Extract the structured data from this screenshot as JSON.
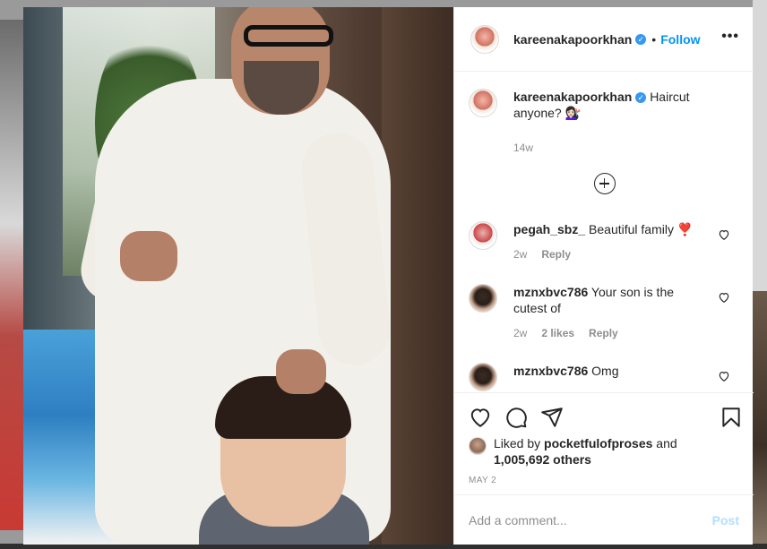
{
  "post": {
    "author": "kareenakapoorkhan",
    "verified_mark": "✓",
    "dot": "•",
    "follow_label": "Follow",
    "more_label": "•••",
    "caption": "Haircut anyone? 💇🏻‍♀️",
    "caption_time": "14w",
    "likes_prefix": "Liked by",
    "liked_by_user": "pocketfulofproses",
    "likes_and": "and",
    "likes_others": "1,005,692 others",
    "date": "MAY 2",
    "add_comment_placeholder": "Add a comment...",
    "post_label": "Post"
  },
  "comments": [
    {
      "user": "pegah_sbz_",
      "text": "Beautiful family ❣️",
      "time": "2w",
      "likes": "",
      "reply": "Reply"
    },
    {
      "user": "mznxbvc786",
      "text": "Your son is the cutest of",
      "time": "2w",
      "likes": "2 likes",
      "reply": "Reply"
    },
    {
      "user": "mznxbvc786",
      "text": "Omg",
      "time": "",
      "likes": "",
      "reply": ""
    }
  ],
  "colors": {
    "follow": "#0095f6",
    "post_disabled": "#b2dffc",
    "verified": "#3897f0",
    "muted": "#8e8e8e"
  },
  "icons": [
    "more-options-icon",
    "verified-badge-icon",
    "add-circle-icon",
    "heart-icon",
    "comment-icon",
    "share-icon",
    "bookmark-icon"
  ]
}
